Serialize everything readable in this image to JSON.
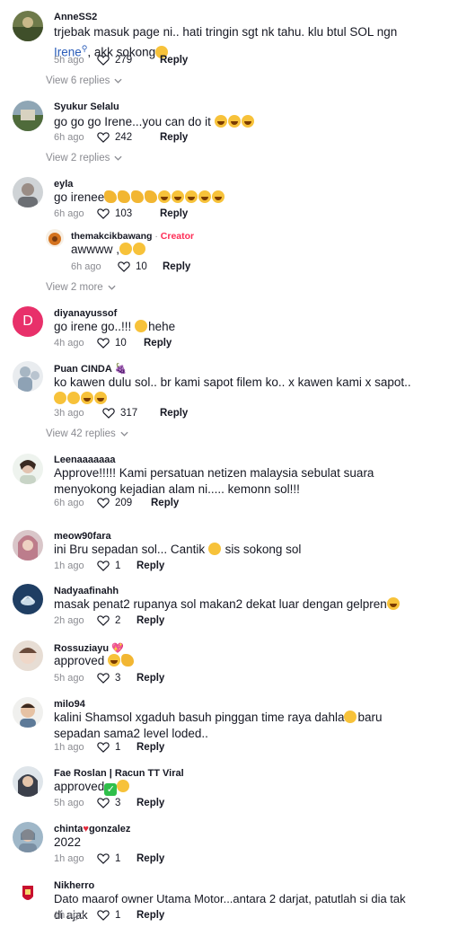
{
  "ui": {
    "reply_label": "Reply"
  },
  "comments": [
    {
      "username": "AnneSS2",
      "text_before": "trjebak masuk page ni.. hati tringin sgt nk tahu. klu btul SOL ngn ",
      "mention": "Irene",
      "text_after": ", akk sokong",
      "time": "5h ago",
      "likes": "279",
      "view_more": "View 6 replies"
    },
    {
      "username": "Syukur Selalu",
      "text": "go go go Irene...you can do it",
      "time": "6h ago",
      "likes": "242",
      "view_more": "View 2 replies"
    },
    {
      "username": "eyla",
      "text": "go irenee",
      "time": "6h ago",
      "likes": "103"
    },
    {
      "username": "diyanayussof",
      "avatar_letter": "D",
      "text_before": "go irene go..!!! ",
      "text_after": "hehe",
      "time": "4h ago",
      "likes": "10"
    },
    {
      "username": "Puan CINDA",
      "text": "ko kawen dulu sol.. br kami sapot filem ko.. x kawen kami x sapot..",
      "time": "3h ago",
      "likes": "317",
      "view_more": "View 42 replies"
    },
    {
      "username": "Leenaaaaaaa",
      "text": "Approve!!!!! Kami persatuan netizen malaysia sebulat suara menyokong kejadian alam ni..... kemonn sol!!!",
      "time": "6h ago",
      "likes": "209"
    },
    {
      "username": "meow90fara",
      "text": "ini Bru sepadan sol... Cantik",
      "text_after": " sis sokong sol",
      "time": "1h ago",
      "likes": "1"
    },
    {
      "username": "Nadyaafinahh",
      "text": "masak penat2 rupanya sol makan2 dekat luar dengan gelpren",
      "time": "2h ago",
      "likes": "2"
    },
    {
      "username": "Rossuziayu",
      "text": "approved",
      "time": "5h ago",
      "likes": "3"
    },
    {
      "username": "milo94",
      "text_before": "kalini Shamsol xgaduh basuh pinggan time raya dahla",
      "text_after": "baru sepadan sama2 level loded..",
      "time": "1h ago",
      "likes": "1"
    },
    {
      "username": "Fae Roslan | Racun TT Viral",
      "text": "approved",
      "time": "5h ago",
      "likes": "3"
    },
    {
      "username_before": "chinta",
      "username_after": "gonzalez",
      "text": "2022",
      "time": "1h ago",
      "likes": "1"
    },
    {
      "username": "Nikherro",
      "text": "Dato maarof owner Utama Motor...antara 2 darjat, patutlah si dia tak di ajak",
      "time": "1h ago",
      "likes": "1"
    }
  ],
  "nested_reply": {
    "username": "themakcikbawang",
    "separator": " · ",
    "badge": "Creator",
    "text": "awwww ,",
    "time": "6h ago",
    "likes": "10",
    "view_more": "View 2 more"
  },
  "colors": {
    "accent": "#fe2c55",
    "mention": "#2b5db9",
    "muted": "#8a8b91",
    "text": "#161823",
    "avatar_d": "#e8306a"
  }
}
